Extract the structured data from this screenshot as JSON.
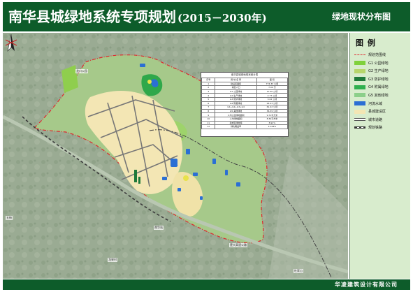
{
  "header": {
    "title": "南华县城绿地系统专项规划",
    "years": "(2015－2030年)",
    "subtitle": "绿地现状分布图"
  },
  "legend": {
    "title": "图 例",
    "items": [
      {
        "label": "规划范围线",
        "kind": "dashline",
        "color": "#e0262c"
      },
      {
        "label": "G1 公园绿地",
        "kind": "fill",
        "color": "#7fd13b"
      },
      {
        "label": "G2 生产绿地",
        "kind": "fill",
        "color": "#b7d66b"
      },
      {
        "label": "G3 防护绿地",
        "kind": "fill",
        "color": "#1f7a3a"
      },
      {
        "label": "G4 附属绿地",
        "kind": "fill",
        "color": "#2fb04e"
      },
      {
        "label": "G5 其他绿地",
        "kind": "fill",
        "color": "#8ccf8a"
      },
      {
        "label": "河流水域",
        "kind": "fill",
        "color": "#2b6fd4"
      },
      {
        "label": "县城建设区",
        "kind": "fill",
        "color": "#f3e6b4"
      },
      {
        "label": "城市道路",
        "kind": "road",
        "color": "#555555"
      },
      {
        "label": "规划铁路",
        "kind": "rail",
        "color": "#333333"
      }
    ]
  },
  "stats_table": {
    "caption": "南华县城绿地现状统计表",
    "headers": [
      "序号",
      "用 地 名 称",
      "面 积"
    ],
    "rows": [
      [
        "1",
        "建设区面积",
        "774.33 公顷"
      ],
      [
        "2",
        "城区人口",
        "7.00 万"
      ],
      [
        "3",
        "G1 公园绿地",
        "17.00 公顷"
      ],
      [
        "4",
        "G2 生产绿地",
        "2.77 公顷"
      ],
      [
        "5",
        "G3 防护绿地",
        "3.02 公顷"
      ],
      [
        "6",
        "G4 附属绿地",
        "24.23 公顷"
      ],
      [
        "7",
        "G1+G2+G3+G4",
        "61.22 公顷"
      ],
      [
        "8",
        "G5 其他绿地",
        "36.39 公顷"
      ],
      [
        "9",
        "人均公园绿地面积",
        "9.71平方米"
      ],
      [
        "10",
        "人均绿地面积",
        "8.39平方米"
      ],
      [
        "11",
        "建成区绿地率",
        "8.91%"
      ],
      [
        "12",
        "绿化覆盖率",
        "13.08%"
      ]
    ]
  },
  "map_labels": {
    "park": "龙川公园",
    "expressway": "楚大高速公路",
    "west_town": "五街",
    "station": "南华站",
    "south_left": "龙泉村",
    "south_right": "杜家山"
  },
  "footer": {
    "company": "华凌建筑设计有限公司"
  }
}
